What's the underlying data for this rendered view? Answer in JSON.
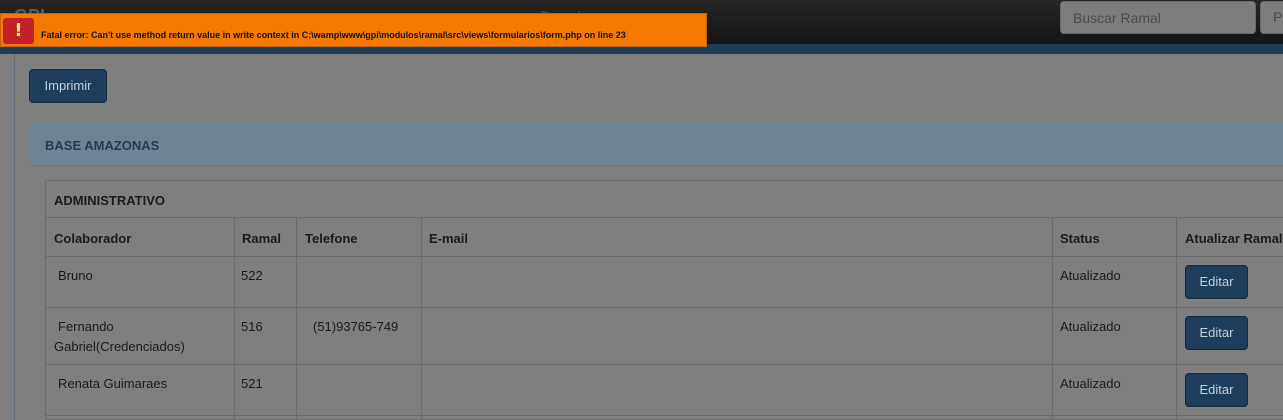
{
  "navbar": {
    "brand": "GPI",
    "nav_item": "Ramais",
    "search_placeholder": "Buscar Ramal",
    "search_button_label": "P"
  },
  "error": {
    "icon": "( ! )",
    "message": "Fatal error: Can't use method return value in write context in C:\\wamp\\www\\gpi\\modulos\\ramal\\src\\views\\formularios\\form.php on line 23"
  },
  "actions": {
    "print_label": "Imprimir"
  },
  "panel": {
    "title": "BASE AMAZONAS"
  },
  "table": {
    "department": "ADMINISTRATIVO",
    "headers": [
      "Colaborador",
      "Ramal",
      "Telefone",
      "E-mail",
      "Status",
      "Atualizar Ramal"
    ],
    "rows": [
      {
        "colaborador": "Bruno",
        "ramal": "522",
        "telefone": "",
        "email": "",
        "status": "Atualizado",
        "action": "Editar"
      },
      {
        "colaborador": "Fernando Gabriel(Credenciados)",
        "colaborador_l1": "Fernando",
        "colaborador_l2": "Gabriel(Credenciados)",
        "ramal": "516",
        "telefone": "(51)93765-749",
        "email": "",
        "status": "Atualizado",
        "action": "Editar"
      },
      {
        "colaborador": "Renata Guimaraes",
        "ramal": "521",
        "telefone": "",
        "email": "",
        "status": "Atualizado",
        "action": "Editar"
      }
    ]
  }
}
